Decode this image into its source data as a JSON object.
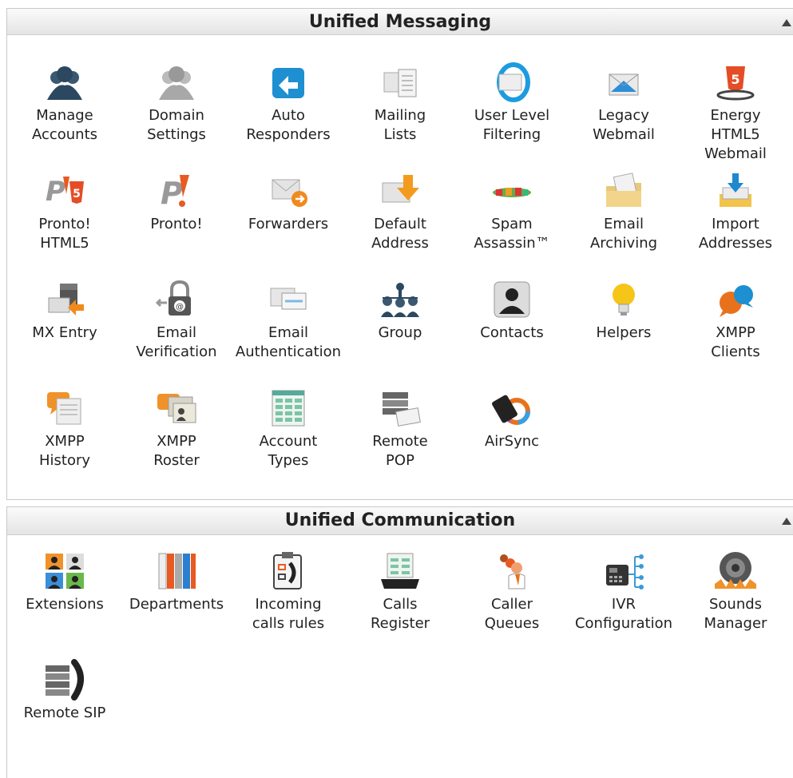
{
  "unified_messaging": {
    "title": "Unified Messaging",
    "items": [
      {
        "label": "Manage\nAccounts",
        "icon": "users-icon"
      },
      {
        "label": "Domain\nSettings",
        "icon": "domain-users-icon"
      },
      {
        "label": "Auto\nResponders",
        "icon": "auto-responder-icon"
      },
      {
        "label": "Mailing\nLists",
        "icon": "mailing-list-icon"
      },
      {
        "label": "User Level\nFiltering",
        "icon": "filter-icon"
      },
      {
        "label": "Legacy\nWebmail",
        "icon": "webmail-envelope-icon"
      },
      {
        "label": "Energy\nHTML5\nWebmail",
        "icon": "html5-shield-icon"
      },
      {
        "label": "Pronto!\nHTML5",
        "icon": "pronto-html5-icon"
      },
      {
        "label": "Pronto!",
        "icon": "pronto-icon"
      },
      {
        "label": "Forwarders",
        "icon": "forward-envelope-icon"
      },
      {
        "label": "Default\nAddress",
        "icon": "default-address-icon"
      },
      {
        "label": "Spam\nAssassin™",
        "icon": "spam-icon"
      },
      {
        "label": "Email\nArchiving",
        "icon": "archive-folder-icon"
      },
      {
        "label": "Import\nAddresses",
        "icon": "import-tray-icon"
      },
      {
        "label": "MX Entry",
        "icon": "mx-server-icon"
      },
      {
        "label": "Email\nVerification",
        "icon": "padlock-icon"
      },
      {
        "label": "Email\nAuthentication",
        "icon": "auth-card-icon"
      },
      {
        "label": "Group",
        "icon": "group-icon"
      },
      {
        "label": "Contacts",
        "icon": "contact-icon"
      },
      {
        "label": "Helpers",
        "icon": "lightbulb-icon"
      },
      {
        "label": "XMPP\nClients",
        "icon": "chat-bubbles-icon"
      },
      {
        "label": "XMPP\nHistory",
        "icon": "chat-history-icon"
      },
      {
        "label": "XMPP\nRoster",
        "icon": "roster-cards-icon"
      },
      {
        "label": "Account\nTypes",
        "icon": "spreadsheet-icon"
      },
      {
        "label": "Remote\nPOP",
        "icon": "remote-pop-icon"
      },
      {
        "label": "AirSync",
        "icon": "airsync-phone-icon"
      }
    ]
  },
  "unified_communication": {
    "title": "Unified Communication",
    "items": [
      {
        "label": "Extensions",
        "icon": "extensions-icon"
      },
      {
        "label": "Departments",
        "icon": "binders-icon"
      },
      {
        "label": "Incoming\ncalls rules",
        "icon": "clipboard-phone-icon"
      },
      {
        "label": "Calls\nRegister",
        "icon": "calls-register-icon"
      },
      {
        "label": "Caller\nQueues",
        "icon": "queue-people-icon"
      },
      {
        "label": "IVR\nConfiguration",
        "icon": "ivr-phone-icon"
      },
      {
        "label": "Sounds\nManager",
        "icon": "speaker-icon"
      },
      {
        "label": "Remote SIP",
        "icon": "remote-sip-icon"
      }
    ]
  },
  "colors": {
    "header_bg_top": "#fbfbfb",
    "header_bg_bottom": "#e4e4e4",
    "text": "#222222"
  }
}
